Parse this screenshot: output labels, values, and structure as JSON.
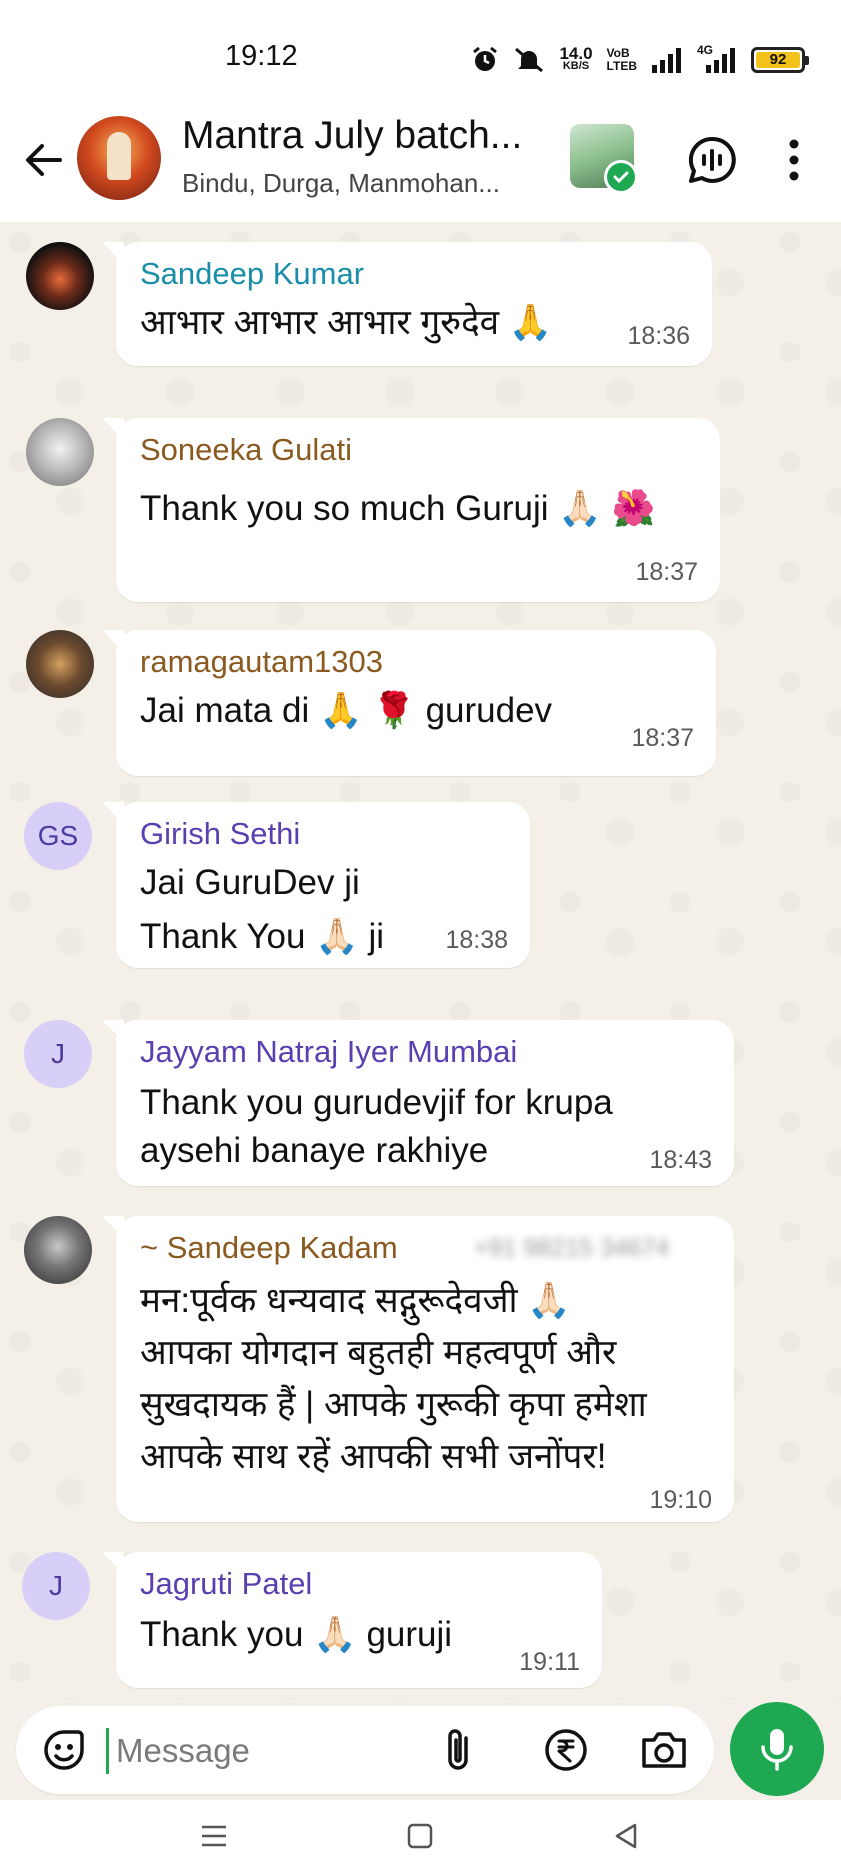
{
  "status_bar": {
    "time": "19:12",
    "net_speed_value": "14.0",
    "net_speed_unit": "KB/S",
    "volte_top": "VoB",
    "volte_bottom": "LTEB",
    "network_4g": "4G",
    "battery": "92"
  },
  "header": {
    "title": "Mantra July batch...",
    "subtitle": "Bindu, Durga, Manmohan..."
  },
  "messages": [
    {
      "sender": "Sandeep Kumar",
      "text": "आभार आभार आभार गुरुदेव 🙏",
      "time": "18:36",
      "color": "#1a8ea8"
    },
    {
      "sender": "Soneeka Gulati",
      "text": "Thank you so much Guruji 🙏🏻 🌺",
      "time": "18:37",
      "color": "#8a5a20"
    },
    {
      "sender": "ramagautam1303",
      "text": "Jai mata di 🙏 🌹 gurudev",
      "time": "18:37",
      "color": "#8a5a20"
    },
    {
      "sender": "Girish Sethi",
      "avatar_initials": "GS",
      "lines": [
        "Jai GuruDev ji",
        "Thank You 🙏🏻 ji"
      ],
      "time": "18:38",
      "color": "#5a3fb0"
    },
    {
      "sender": "Jayyam Natraj Iyer Mumbai",
      "avatar_initials": "J",
      "lines": [
        "Thank you gurudevjif for krupa",
        "aysehi banaye rakhiye"
      ],
      "time": "18:43",
      "color": "#5a3fb0"
    },
    {
      "sender": "~ Sandeep Kadam",
      "phone": "+91 98215 34674",
      "lines": [
        "मन:पूर्वक धन्यवाद सद्गुरूदेवजी 🙏🏻",
        "आपका योगदान बहुतही महत्वपूर्ण और",
        "सुखदायक हैं | आपके गुरूकी कृपा हमेशा",
        "आपके साथ रहें आपकी सभी जनोंपर!"
      ],
      "time": "19:10",
      "color": "#8a5a20"
    },
    {
      "sender": "Jagruti Patel",
      "avatar_initials": "J",
      "text": "Thank you 🙏🏻 guruji",
      "time": "19:11",
      "color": "#5a3fb0"
    }
  ],
  "input": {
    "placeholder": "Message"
  },
  "colors": {
    "accent": "#1da851",
    "chat_bg": "#f4f0e8"
  }
}
